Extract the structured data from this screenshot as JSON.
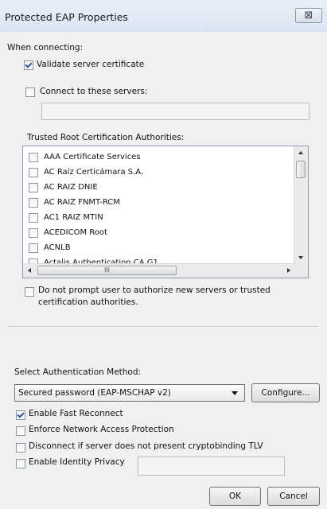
{
  "window": {
    "title": "Protected EAP Properties",
    "close_glyph": "⊠"
  },
  "connecting": {
    "heading": "When connecting:",
    "validate_cert": {
      "label": "Validate server certificate",
      "checked": true
    },
    "connect_servers": {
      "label": "Connect to these servers:",
      "checked": false,
      "value": ""
    },
    "trusted_heading": "Trusted Root Certification Authorities:",
    "authorities": [
      "AAA Certificate Services",
      "AC Raíz Certicámara S.A.",
      "AC RAIZ DNIE",
      "AC RAIZ FNMT-RCM",
      "AC1 RAIZ MTIN",
      "ACEDICOM Root",
      "ACNLB",
      "Actalis Authentication CA G1"
    ],
    "hscroll_grip": "III",
    "no_prompt": {
      "label_line1": "Do not prompt user to authorize new servers or trusted",
      "label_line2": "certification authorities.",
      "checked": false
    }
  },
  "auth": {
    "heading": "Select Authentication Method:",
    "method_value": "Secured password (EAP-MSCHAP v2)",
    "configure_label": "Configure...",
    "options": [
      {
        "label": "Enable Fast Reconnect",
        "checked": true
      },
      {
        "label": "Enforce Network Access Protection",
        "checked": false
      },
      {
        "label": "Disconnect if server does not present cryptobinding TLV",
        "checked": false
      },
      {
        "label": "Enable Identity Privacy",
        "checked": false
      }
    ],
    "identity_value": ""
  },
  "footer": {
    "ok_label": "OK",
    "cancel_label": "Cancel"
  },
  "colors": {
    "titlebar": "#dbe5f2",
    "dialog_bg": "#f0f0f0",
    "check": "#2b4d9b"
  }
}
